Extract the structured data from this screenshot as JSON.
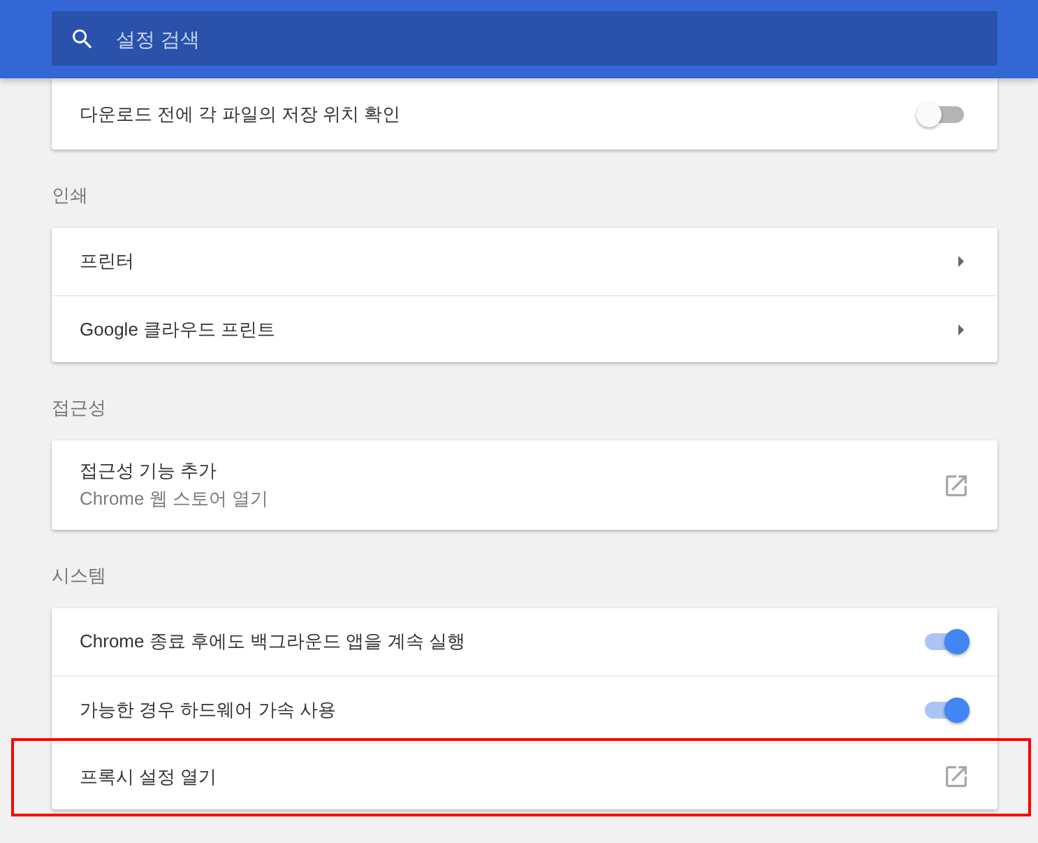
{
  "search": {
    "placeholder": "설정 검색"
  },
  "sections": [
    {
      "items": [
        {
          "kind": "toggle",
          "label": "다운로드 전에 각 파일의 저장 위치 확인",
          "on": false,
          "highlighted": false
        }
      ]
    },
    {
      "title": "인쇄",
      "items": [
        {
          "kind": "arrow",
          "label": "프린터",
          "highlighted": false
        },
        {
          "kind": "arrow",
          "label": "Google 클라우드 프린트",
          "highlighted": false
        }
      ]
    },
    {
      "title": "접근성",
      "items": [
        {
          "kind": "external",
          "label": "접근성 기능 추가",
          "sublabel": "Chrome 웹 스토어 열기",
          "highlighted": false
        }
      ]
    },
    {
      "title": "시스템",
      "items": [
        {
          "kind": "toggle",
          "label": "Chrome 종료 후에도 백그라운드 앱을 계속 실행",
          "on": true,
          "highlighted": false
        },
        {
          "kind": "toggle",
          "label": "가능한 경우 하드웨어 가속 사용",
          "on": true,
          "highlighted": false
        },
        {
          "kind": "external",
          "label": "프록시 설정 열기",
          "highlighted": true
        }
      ]
    }
  ]
}
